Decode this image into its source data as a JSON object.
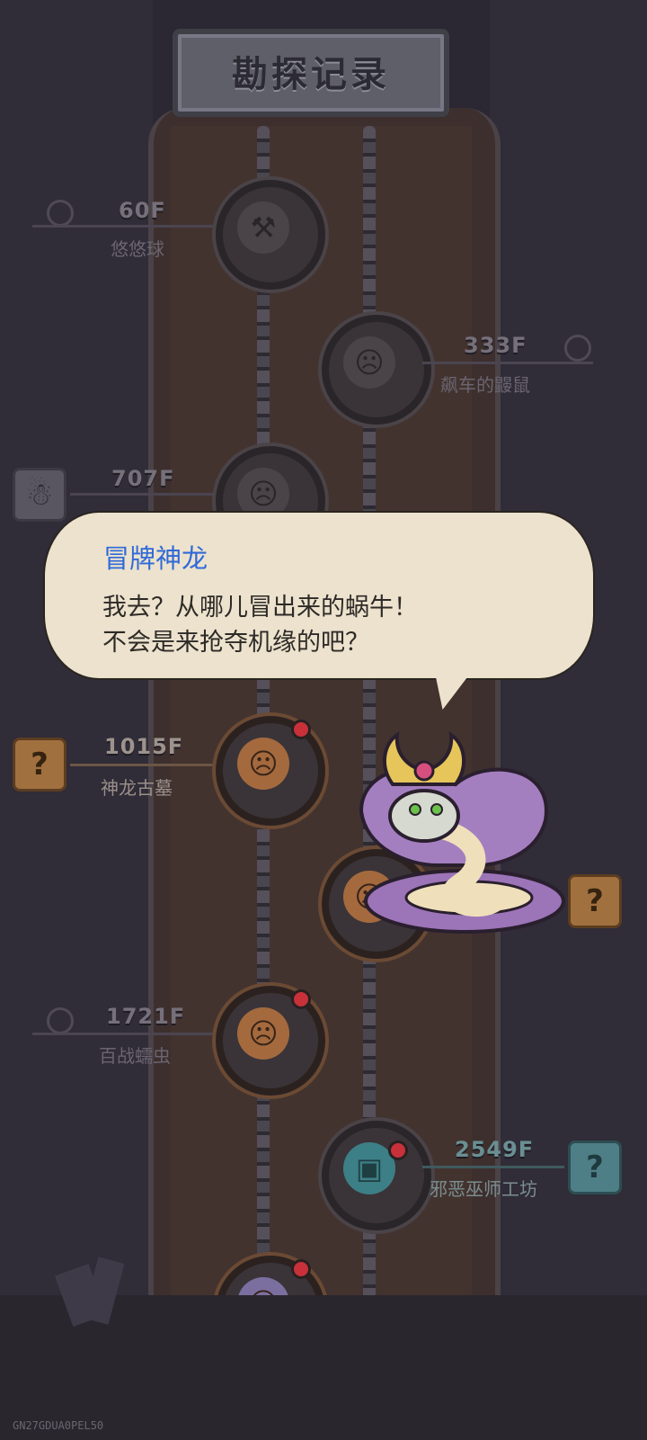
{
  "header": {
    "title": "勘探记录"
  },
  "floors": [
    {
      "floor": "60F",
      "name": "悠悠球"
    },
    {
      "floor": "333F",
      "name": "飙车的鼹鼠"
    },
    {
      "floor": "707F",
      "name": ""
    },
    {
      "floor": "1015F",
      "name": "神龙古墓"
    },
    {
      "floor": "1721F",
      "name": "百战蠕虫"
    },
    {
      "floor": "2549F",
      "name": "邪恶巫师工坊"
    }
  ],
  "dialog": {
    "speaker": "冒牌神龙",
    "lines": [
      "我去？从哪儿冒出来的蜗牛！",
      "不会是来抢夺机缘的吧？"
    ]
  },
  "question_mark": "?",
  "colors": {
    "speaker": "#2f6ad8",
    "bubble": "#ece2cd",
    "highlight": "#a46a3e"
  },
  "icons": {
    "node_pickaxe": "pickaxe-icon",
    "node_monster": "monster-face-icon",
    "node_tv": "tv-icon"
  },
  "watermark": "GN27GDUA0PEL50"
}
